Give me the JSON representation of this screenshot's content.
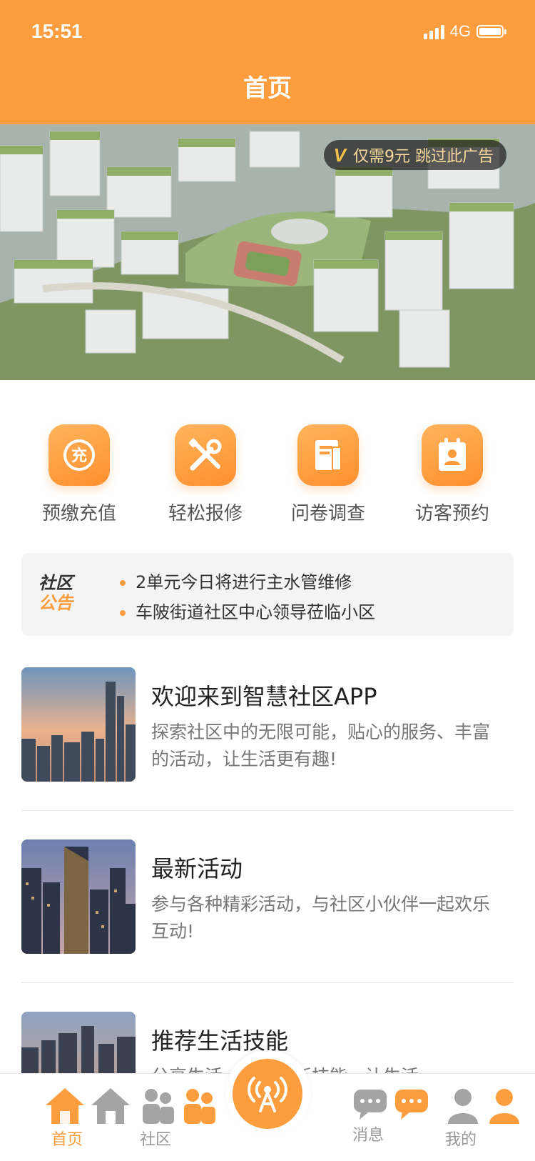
{
  "status_bar": {
    "time": "15:51",
    "network": "4G"
  },
  "header": {
    "title": "首页"
  },
  "banner": {
    "ad_badge": "V",
    "ad_skip_text": "仅需9元 跳过此广告"
  },
  "services": [
    {
      "label": "预缴充值",
      "icon": "recharge-icon",
      "glyph": "充"
    },
    {
      "label": "轻松报修",
      "icon": "repair-tools-icon"
    },
    {
      "label": "问卷调查",
      "icon": "survey-document-icon"
    },
    {
      "label": "访客预约",
      "icon": "visitor-badge-icon"
    }
  ],
  "notice": {
    "badge_line1": "社区",
    "badge_line2": "公告",
    "items": [
      "2单元今日将进行主水管维修",
      "车陂街道社区中心领导莅临小区"
    ]
  },
  "articles": [
    {
      "title": "欢迎来到智慧社区APP",
      "desc": "探索社区中的无限可能，贴心的服务、丰富的活动，让生活更有趣!"
    },
    {
      "title": "最新活动",
      "desc": "参与各种精彩活动，与社区小伙伴一起欢乐互动!"
    },
    {
      "title": "推荐生活技能",
      "desc": "分享生活……学习新技能，让生活"
    }
  ],
  "tabbar": {
    "home": "首页",
    "community": "社区",
    "messages": "消息",
    "mine": "我的",
    "colors": {
      "active": "#fd9d3e",
      "inactive": "#999999"
    }
  },
  "colors": {
    "brand": "#fd9d3e"
  }
}
